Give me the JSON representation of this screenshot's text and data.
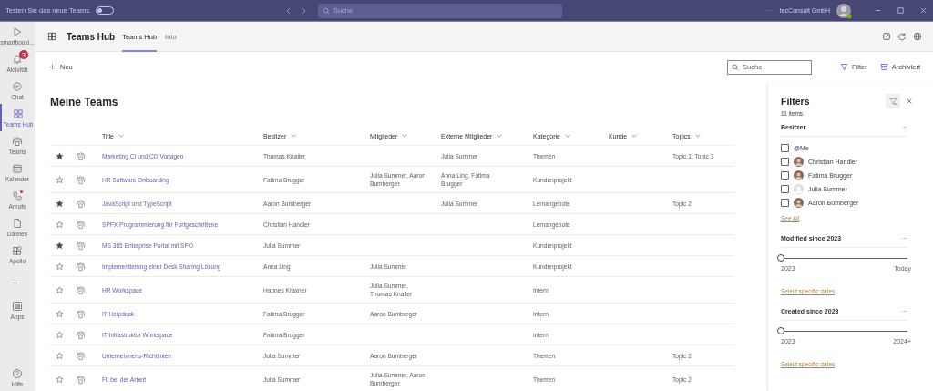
{
  "title_bar": {
    "promo": "Testen Sie das neue Teams.",
    "promo_toggle": {
      "on": false
    },
    "search": {
      "placeholder": "Suche"
    },
    "more": "···",
    "org": "tecConsult GmbH"
  },
  "rail": [
    {
      "label": "smartbooki...",
      "selected": false,
      "alert": false
    },
    {
      "label": "Aktivität",
      "selected": false,
      "alert": false,
      "badge": "3"
    },
    {
      "label": "Chat",
      "selected": false,
      "alert": false
    },
    {
      "label": "Teams Hub",
      "selected": true,
      "alert": false
    },
    {
      "label": "Teams",
      "selected": false,
      "alert": false
    },
    {
      "label": "Kalender",
      "selected": false,
      "alert": false
    },
    {
      "label": "Anrufe",
      "selected": false,
      "alert": true
    },
    {
      "label": "Dateien",
      "selected": false,
      "alert": false
    },
    {
      "label": "Apollo",
      "selected": false,
      "alert": false
    },
    {
      "label": "···",
      "selected": false,
      "alert": false
    },
    {
      "label": "Apps",
      "selected": false,
      "alert": false
    }
  ],
  "rail_help": {
    "label": "Hilfe"
  },
  "app_header": {
    "title": "Teams Hub",
    "tabs": [
      {
        "label": "Teams Hub",
        "selected": true
      },
      {
        "label": "Info",
        "selected": false
      }
    ]
  },
  "toolbar": {
    "new": "Neu",
    "search": {
      "placeholder": "Suche"
    },
    "filter": "Filter",
    "archived": "Archiviert"
  },
  "list": {
    "heading": "Meine Teams",
    "columns": [
      "Title",
      "Besitzer",
      "Mitglieder",
      "Externe Mitglieder",
      "Kategorie",
      "Kunde",
      "Topics"
    ],
    "rows": [
      {
        "favorite": true,
        "title": "Marketing CI und CD Vorlagen",
        "owner": "Thomas Knaller",
        "external": "Julia Summer",
        "category": "Themen",
        "topics": "Topic 1, Topic 3"
      },
      {
        "favorite": false,
        "title": "HR Software Onboarding",
        "owner": "Fatima Brugger",
        "members": "Julia Summer, Aaron Bumberger",
        "external": "Anna Ling, Fatima Brugger",
        "category": "Kundenprojekt"
      },
      {
        "favorite": true,
        "title": "JavaScript und TypeScript",
        "owner": "Aaron Bumberger",
        "external": "Julia Summer",
        "category": "Lernangebote",
        "topics": "Topic 2"
      },
      {
        "favorite": false,
        "title": "SPFX Programmierung für Fortgeschrittene",
        "owner": "Christian Handler",
        "category": "Lernangebote"
      },
      {
        "favorite": true,
        "title": "MS 365 Enterprise Portal mit SPO",
        "owner": "Julia Summer",
        "category": "Kundenprojekt"
      },
      {
        "favorite": false,
        "title": "Implementierung einer Desk Sharing Lösung",
        "owner": "Anna Ling",
        "members": "Julia Summer",
        "category": "Kundenprojekt"
      },
      {
        "favorite": false,
        "title": "HR Workspace",
        "owner": "Hannes Kraxner",
        "members": "Julia Summer, Thomas Knaller",
        "category": "Intern"
      },
      {
        "favorite": false,
        "title": "IT Helpdesk",
        "owner": "Fatima Brugger",
        "members": "Aaron Bumberger",
        "category": "Intern"
      },
      {
        "favorite": false,
        "title": "IT Infrastruktur Workspace",
        "owner": "Fatima Brugger",
        "category": "Intern"
      },
      {
        "favorite": false,
        "title": "Unternehmens-Richtlinien",
        "owner": "Julia Summer",
        "members": "Aaron Bumberger",
        "category": "Themen",
        "topics": "Topic 2"
      },
      {
        "favorite": false,
        "title": "Fit bei der Arbeit",
        "owner": "Julia Summer",
        "members": "Julia Summer, Aaron Bumberger",
        "category": "Themen",
        "topics": "Topic 2"
      }
    ]
  },
  "filters": {
    "title": "Filters",
    "count": "11 items",
    "owner_section": {
      "title": "Besitzer",
      "more": "···",
      "options": [
        {
          "label": "@Me",
          "checked": false,
          "kind": "plain"
        },
        {
          "label": "Christian Handler",
          "checked": false,
          "kind": "person"
        },
        {
          "label": "Fatima Brugger",
          "checked": false,
          "kind": "person"
        },
        {
          "label": "Julia Summer",
          "checked": false,
          "kind": "placeholder"
        },
        {
          "label": "Aaron Bumberger",
          "checked": false,
          "kind": "person"
        }
      ],
      "see_all": "See All"
    },
    "date_sections": [
      {
        "title": "Modified since 2023",
        "more": "···",
        "level": 0,
        "min_label": "2023",
        "max_label": "Today",
        "link": "Select specific dates"
      },
      {
        "title": "Created since 2023",
        "more": "···",
        "level": 0,
        "min_label": "2023",
        "max_label": "2024+",
        "link": "Select specific dates"
      }
    ]
  }
}
